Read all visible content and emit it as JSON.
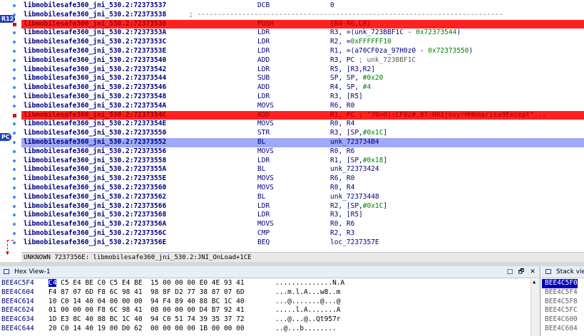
{
  "disasm": {
    "rows": [
      {
        "addr": "libmobilesafe360_jni_530.2:72373537",
        "mn": "DCB",
        "op": "0",
        "kind": "",
        "gutter": "dot"
      },
      {
        "addr": "libmobilesafe360_jni_530.2:72373538",
        "mn": "",
        "op": "; ---------------------------------------------------------------------------",
        "kind": "sep",
        "gutter": "dot"
      },
      {
        "addr": "libmobilesafe360_jni_530.2:72373538",
        "mn": "PUSH",
        "op": "{R4-R6,LR}",
        "kind": "bp",
        "gutter": "bp"
      },
      {
        "addr": "libmobilesafe360_jni_530.2:7237353A",
        "mn": "LDR",
        "op": "R3, =(unk_723BBF1C - 0x72373544)",
        "kind": "",
        "gutter": "dot"
      },
      {
        "addr": "libmobilesafe360_jni_530.2:7237353C",
        "mn": "LDR",
        "op": "R2, =0xFFFFFF10",
        "kind": "",
        "gutter": "dot"
      },
      {
        "addr": "libmobilesafe360_jni_530.2:7237353E",
        "mn": "LDR",
        "op": "R1, =(a70CF0za_97H0z0 - 0x72373550)",
        "kind": "",
        "gutter": "dot"
      },
      {
        "addr": "libmobilesafe360_jni_530.2:72373540",
        "mn": "ADD",
        "op": "R3, PC ; unk_723BBF1C",
        "kind": "",
        "gutter": "dot"
      },
      {
        "addr": "libmobilesafe360_jni_530.2:72373542",
        "mn": "LDR",
        "op": "R5, [R3,R2]",
        "kind": "",
        "gutter": "dot"
      },
      {
        "addr": "libmobilesafe360_jni_530.2:72373544",
        "mn": "SUB",
        "op": "SP, SP, #0x20",
        "kind": "",
        "gutter": "dot"
      },
      {
        "addr": "libmobilesafe360_jni_530.2:72373546",
        "mn": "ADD",
        "op": "R4, SP, #4",
        "kind": "",
        "gutter": "dot"
      },
      {
        "addr": "libmobilesafe360_jni_530.2:72373548",
        "mn": "LDR",
        "op": "R3, [R5]",
        "kind": "",
        "gutter": "dot"
      },
      {
        "addr": "libmobilesafe360_jni_530.2:7237354A",
        "mn": "MOVS",
        "op": "R6, R0",
        "kind": "",
        "gutter": "dot"
      },
      {
        "addr": "libmobilesafe360_jni_530.2:7237354C",
        "mn": "ADD",
        "op": "R1, PC ; \"70>0|:CF0z#.97:H0z|ovyrHH6marisa9Except\"...",
        "kind": "bp",
        "gutter": "bp"
      },
      {
        "addr": "libmobilesafe360_jni_530.2:7237354E",
        "mn": "MOVS",
        "op": "R0, R4",
        "kind": "",
        "gutter": "dot"
      },
      {
        "addr": "libmobilesafe360_jni_530.2:72373550",
        "mn": "STR",
        "op": "R3, [SP,#0x1C]",
        "kind": "",
        "gutter": "dot"
      },
      {
        "addr": "libmobilesafe360_jni_530.2:72373552",
        "mn": "BL",
        "op": "unk_723734B4",
        "kind": "pc",
        "gutter": "dot"
      },
      {
        "addr": "libmobilesafe360_jni_530.2:72373556",
        "mn": "MOVS",
        "op": "R0, R6",
        "kind": "",
        "gutter": "dot"
      },
      {
        "addr": "libmobilesafe360_jni_530.2:72373558",
        "mn": "LDR",
        "op": "R1, [SP,#0x18]",
        "kind": "",
        "gutter": "dot"
      },
      {
        "addr": "libmobilesafe360_jni_530.2:7237355A",
        "mn": "BL",
        "op": "unk_72373424",
        "kind": "",
        "gutter": "dot"
      },
      {
        "addr": "libmobilesafe360_jni_530.2:7237355E",
        "mn": "MOVS",
        "op": "R6, R0",
        "kind": "",
        "gutter": "dot"
      },
      {
        "addr": "libmobilesafe360_jni_530.2:72373560",
        "mn": "MOVS",
        "op": "R0, R4",
        "kind": "",
        "gutter": "dot"
      },
      {
        "addr": "libmobilesafe360_jni_530.2:72373562",
        "mn": "BL",
        "op": "unk_72373448",
        "kind": "",
        "gutter": "dot"
      },
      {
        "addr": "libmobilesafe360_jni_530.2:72373566",
        "mn": "LDR",
        "op": "R2, [SP,#0x1C]",
        "kind": "",
        "gutter": "dot"
      },
      {
        "addr": "libmobilesafe360_jni_530.2:72373568",
        "mn": "LDR",
        "op": "R3, [R5]",
        "kind": "",
        "gutter": "dot"
      },
      {
        "addr": "libmobilesafe360_jni_530.2:7237356A",
        "mn": "MOVS",
        "op": "R0, R6",
        "kind": "",
        "gutter": "dot"
      },
      {
        "addr": "libmobilesafe360_jni_530.2:7237356C",
        "mn": "CMP",
        "op": "R2, R3",
        "kind": "",
        "gutter": "dot"
      },
      {
        "addr": "libmobilesafe360_jni_530.2:7237356E",
        "mn": "BEQ",
        "op": "loc_7237357E",
        "kind": "",
        "gutter": "dot"
      }
    ],
    "register_tags": {
      "r12": "R12",
      "pc": "PC"
    },
    "status": "UNKNOWN 7237356E: libmobilesafe360_jni_530.2:JNI_OnLoad+1CE"
  },
  "hex_view": {
    "title": "Hex View-1",
    "buttons": {
      "minimize": "□",
      "restore": "🗗",
      "close": "✕"
    },
    "rows": [
      {
        "addr": "BEE4C5F4",
        "sel": "C4",
        "bytes": " C5 E4 BE C0 C5 E4 BE  15 00 00 00 E0 4E 93 41",
        "ascii": "..............N.A"
      },
      {
        "addr": "BEE4C604",
        "sel": "",
        "bytes": "F4 87 07 6D F8 6C 98 41  98 8F D2 77 38 87 07 6D",
        "ascii": "...m.l.A...w8..m"
      },
      {
        "addr": "BEE4C614",
        "sel": "",
        "bytes": "10 C0 14 40 04 00 00 00  94 F4 89 40 88 BC 1C 40",
        "ascii": "...@.......@...@"
      },
      {
        "addr": "BEE4C624",
        "sel": "",
        "bytes": "01 00 00 00 F8 6C 98 41  08 00 00 00 D4 B7 92 41",
        "ascii": ".....l.A.......A"
      },
      {
        "addr": "BEE4C634",
        "sel": "",
        "bytes": "1D E3 8C 40 88 BC 1C 40  94 C0 51 74 39 35 37 72",
        "ascii": "...@...@..Qt957r"
      },
      {
        "addr": "BEE4C644",
        "sel": "",
        "bytes": "20 C0 14 40 19 00 D0 62  00 00 00 00 1B 00 00 00",
        "ascii": "..@...b........"
      }
    ]
  },
  "stack_view": {
    "title": "Stack view",
    "rows": [
      "BEE4C5F0",
      "BEE4C5F4",
      "BEE4C5F8",
      "BEE4C5FC",
      "BEE4C600",
      "BEE4C604"
    ]
  }
}
